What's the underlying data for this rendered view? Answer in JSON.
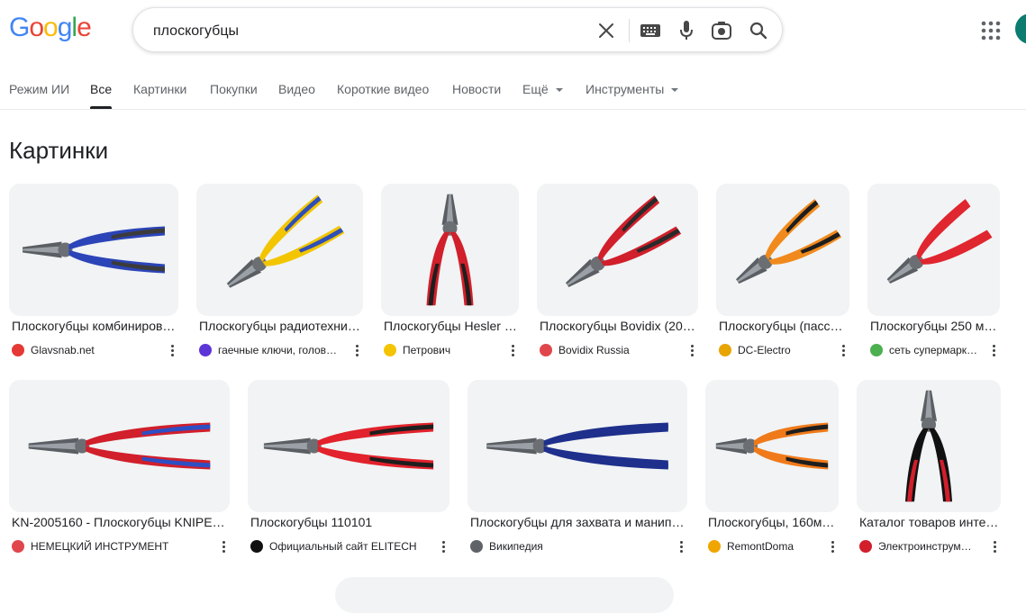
{
  "logo": {
    "text": "Google"
  },
  "search": {
    "query": "плоскогубцы",
    "clear_icon": "close-icon",
    "keyboard_icon": "keyboard-icon",
    "voice_icon": "mic-icon",
    "lens_icon": "lens-icon",
    "search_icon": "search-icon"
  },
  "tabs": [
    {
      "label": "Режим ИИ"
    },
    {
      "label": "Все"
    },
    {
      "label": "Картинки"
    },
    {
      "label": "Покупки"
    },
    {
      "label": "Видео"
    },
    {
      "label": "Короткие видео"
    },
    {
      "label": "Новости"
    },
    {
      "label": "Ещё"
    },
    {
      "label": "Инструменты"
    }
  ],
  "section_title": "Картинки",
  "images": [
    {
      "title": "Плоскогубцы комбиниров…",
      "source": "Glavsnab.net",
      "handle": "#2b44b8",
      "grip": "#3b3b3b"
    },
    {
      "title": "Плоскогубцы радиотехни…",
      "source": "гаечные ключи, голов…",
      "handle": "#f2c500",
      "grip": "#2f4fb8"
    },
    {
      "title": "Плоскогубцы Hesler …",
      "source": "Петрович",
      "handle": "#d11f2b",
      "grip": "#1e1e1e"
    },
    {
      "title": "Плоскогубцы Bovidix (20…",
      "source": "Bovidix Russia",
      "handle": "#d11f2b",
      "grip": "#2a2a2a"
    },
    {
      "title": "Плоскогубцы (пасса…",
      "source": "DC-Electro",
      "handle": "#f08a1c",
      "grip": "#1e1e1e"
    },
    {
      "title": "Плоскогубцы 250 м…",
      "source": "сеть супермарк…",
      "handle": "#e0262f",
      "grip": "#e0262f"
    },
    {
      "title": "KN-2005160 - Плоскогубцы KNIPEX…",
      "source": "НЕМЕЦКИЙ ИНСТРУМЕНТ",
      "handle": "#d11f2b",
      "grip": "#2d4fc4"
    },
    {
      "title": "Плоскогубцы 110101",
      "source": "Официальный сайт ELITECH",
      "handle": "#e2222c",
      "grip": "#1e1e1e"
    },
    {
      "title": "Плоскогубцы для захвата и манипу…",
      "source": "Википедия",
      "handle": "#1e2f8c",
      "grip": "#1e2f8c"
    },
    {
      "title": "Плоскогубцы, 160м…",
      "source": "RemontDoma",
      "handle": "#f07a1a",
      "grip": "#1e1e1e"
    },
    {
      "title": "Каталог товаров инте…",
      "source": "Электроинструм…",
      "handle": "#111111",
      "grip": "#d11f2b"
    }
  ],
  "favicon_colors": [
    "#e53935",
    "#5c35d6",
    "#f5c400",
    "#e0474c",
    "#e8a400",
    "#4caf50",
    "#e0474c",
    "#111111",
    "#5f6368",
    "#f0a500",
    "#d11f2b"
  ],
  "icons": {
    "apps": "apps-grid-icon",
    "more": "more-vert-icon"
  }
}
